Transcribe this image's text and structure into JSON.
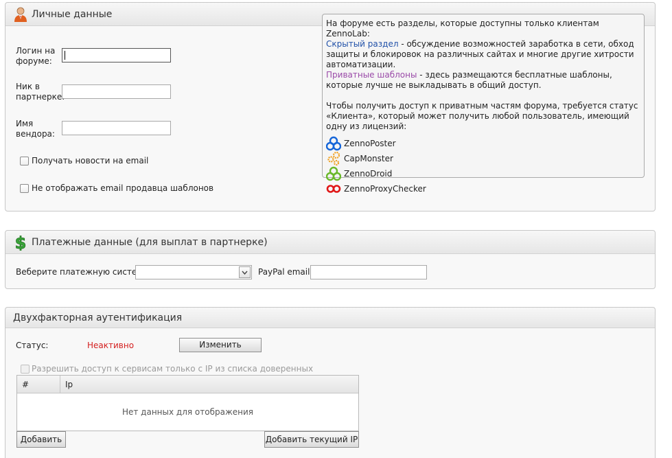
{
  "personal": {
    "title": "Личные данные",
    "login_label_1": "Логин на",
    "login_label_2": "форуме:",
    "nick_label_1": "Ник в",
    "nick_label_2": "партнерке:",
    "vendor_label_1": "Имя",
    "vendor_label_2": "вендора:",
    "news_label": "Получать новости на email",
    "hide_email_label": "Не отображать email продавца шаблонов",
    "info": {
      "intro": "На форуме есть разделы, которые доступны только клиентам ZennoLab:",
      "hidden_link": "Скрытый раздел",
      "hidden_text": " - обсуждение возможностей заработка в сети, обход защиты и блокировок на различных сайтах и многие другие хитрости автоматизации.",
      "private_link": "Приватные шаблоны",
      "private_text": " - здесь размещаются бесплатные шаблоны, которые лучше не выкладывать в общий доступ.",
      "access_text": "Чтобы получить доступ к приватным частям форума, требуется статус «Клиента», который может получить любой пользователь, имеющий одну из лицензий:",
      "products": [
        "ZennoPoster",
        "CapMonster",
        "ZennoDroid",
        "ZennoProxyChecker"
      ]
    }
  },
  "payment": {
    "title": "Платежные данные (для выплат в партнерке)",
    "system_label": "Веберите платежную систему:",
    "paypal_label": "PayPal email:"
  },
  "twofa": {
    "title": "Двухфакторная аутентификация",
    "status_label": "Статус:",
    "status_value": "Неактивно",
    "change_button": "Изменить",
    "ip_restrict_label": "Разрешить доступ к сервисам только с IP из списка доверенных",
    "col_num": "#",
    "col_ip": "Ip",
    "empty_text": "Нет данных для отображения",
    "add_button": "Добавить",
    "add_current_button": "Добавить текущий IP"
  },
  "colors": {
    "status_inactive": "#d42020",
    "link_blue": "#2050a8",
    "link_violet": "#9a4aa8"
  }
}
